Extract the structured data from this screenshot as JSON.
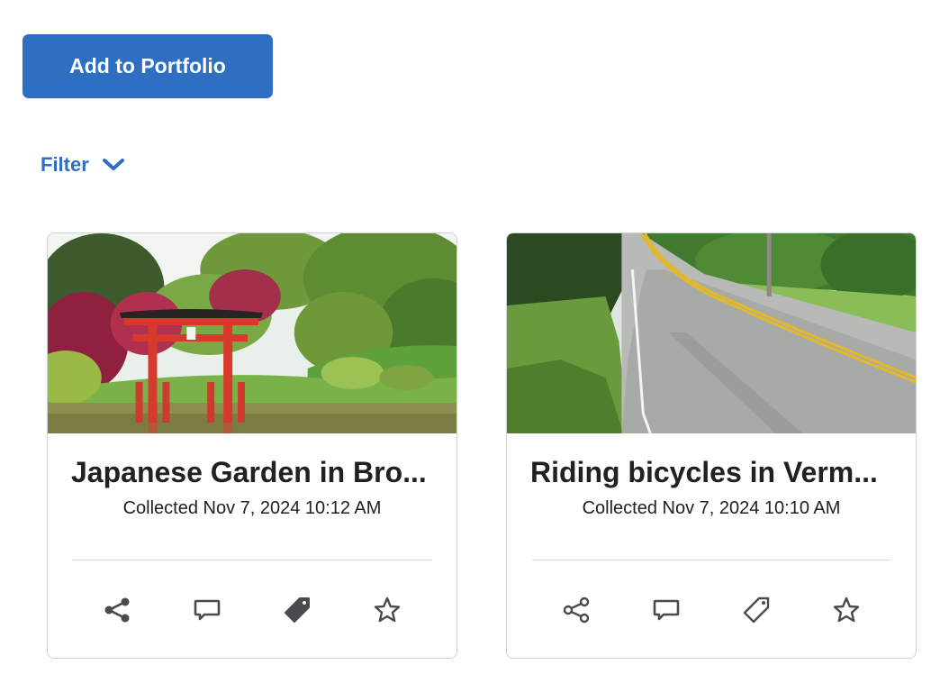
{
  "toolbar": {
    "add_label": "Add to Portfolio"
  },
  "filter": {
    "label": "Filter",
    "icon": "chevron-down-icon"
  },
  "cards": [
    {
      "title": "Japanese Garden in Bro...",
      "collected": "Collected Nov 7, 2024 10:12 AM",
      "image": "japanese-garden-torii-gate",
      "tagged": true
    },
    {
      "title": "Riding bicycles in Verm...",
      "collected": "Collected Nov 7, 2024 10:10 AM",
      "image": "country-road",
      "tagged": false
    }
  ],
  "actions": [
    "share-icon",
    "comment-icon",
    "tag-icon",
    "star-icon"
  ],
  "colors": {
    "accent": "#2f6fc1",
    "text": "#202122",
    "icon": "#494c4e"
  }
}
